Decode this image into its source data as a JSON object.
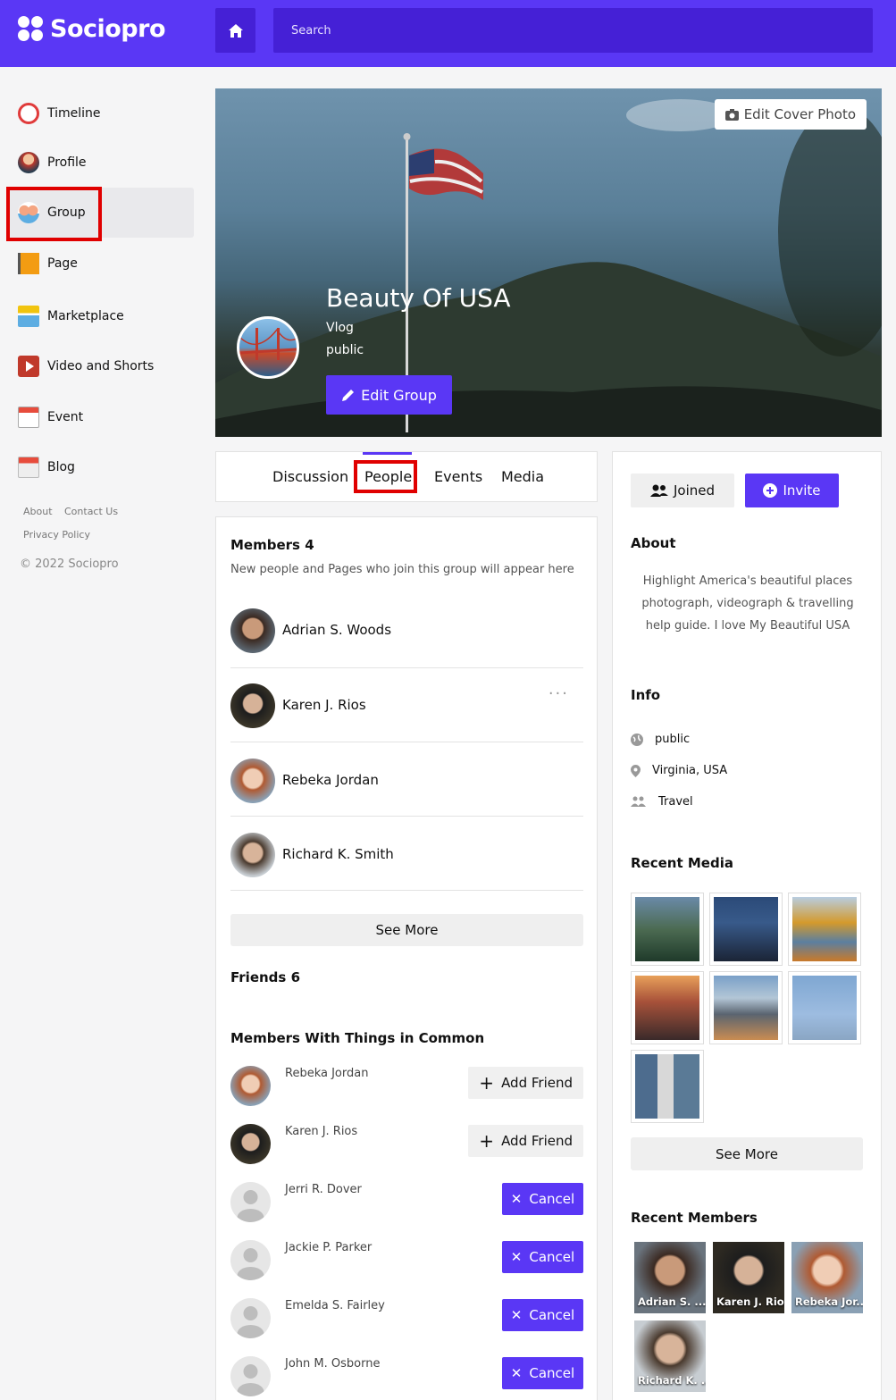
{
  "app": {
    "name": "Sociopro",
    "search_placeholder": "Search"
  },
  "sidebar": {
    "items": [
      {
        "label": "Timeline",
        "icon": "timeline-icon"
      },
      {
        "label": "Profile",
        "icon": "profile-icon"
      },
      {
        "label": "Group",
        "icon": "group-icon",
        "active": true
      },
      {
        "label": "Page",
        "icon": "page-flag-icon"
      },
      {
        "label": "Marketplace",
        "icon": "marketplace-icon"
      },
      {
        "label": "Video and Shorts",
        "icon": "video-icon"
      },
      {
        "label": "Event",
        "icon": "calendar-icon"
      },
      {
        "label": "Blog",
        "icon": "blog-icon"
      }
    ],
    "footer_links": [
      "About",
      "Contact Us",
      "Privacy Policy"
    ],
    "copyright": "© 2022 Sociopro"
  },
  "cover": {
    "edit_cover_label": "Edit Cover Photo",
    "group_name": "Beauty Of USA",
    "category": "Vlog",
    "privacy": "public",
    "edit_group_label": "Edit Group"
  },
  "tabs": [
    {
      "label": "Discussion"
    },
    {
      "label": "People",
      "active": true
    },
    {
      "label": "Events"
    },
    {
      "label": "Media"
    }
  ],
  "members": {
    "title": "Members 4",
    "subtitle": "New people and Pages who join this group will appear here",
    "list": [
      "Adrian S. Woods",
      "Karen J. Rios",
      "Rebeka Jordan",
      "Richard K. Smith"
    ],
    "see_more": "See More"
  },
  "friends": {
    "title": "Friends 6"
  },
  "common": {
    "title": "Members With Things in Common",
    "list": [
      {
        "name": "Rebeka Jordan",
        "action": "Add Friend"
      },
      {
        "name": "Karen J. Rios",
        "action": "Add Friend"
      },
      {
        "name": "Jerri R. Dover",
        "action": "Cancel"
      },
      {
        "name": "Jackie P. Parker",
        "action": "Cancel"
      },
      {
        "name": "Emelda S. Fairley",
        "action": "Cancel"
      },
      {
        "name": "John M. Osborne",
        "action": "Cancel"
      }
    ]
  },
  "right": {
    "joined_label": "Joined",
    "invite_label": "Invite",
    "about_title": "About",
    "about_text": "Highlight America's beautiful places photograph, videograph & travelling help guide. I love My Beautiful USA",
    "info_title": "Info",
    "info": [
      {
        "icon": "globe-icon",
        "text": "public"
      },
      {
        "icon": "location-pin-icon",
        "text": "Virginia, USA"
      },
      {
        "icon": "people-icon",
        "text": "Travel"
      }
    ],
    "media_title": "Recent Media",
    "media_see_more": "See More",
    "recent_members_title": "Recent Members",
    "recent_members": [
      "Adrian S. ...",
      "Karen J. Rios",
      "Rebeka Jor...",
      "Richard K. ..."
    ]
  },
  "colors": {
    "brand": "#5a37f5",
    "brand_dark": "#4520d6",
    "highlight_box": "#e00000"
  }
}
